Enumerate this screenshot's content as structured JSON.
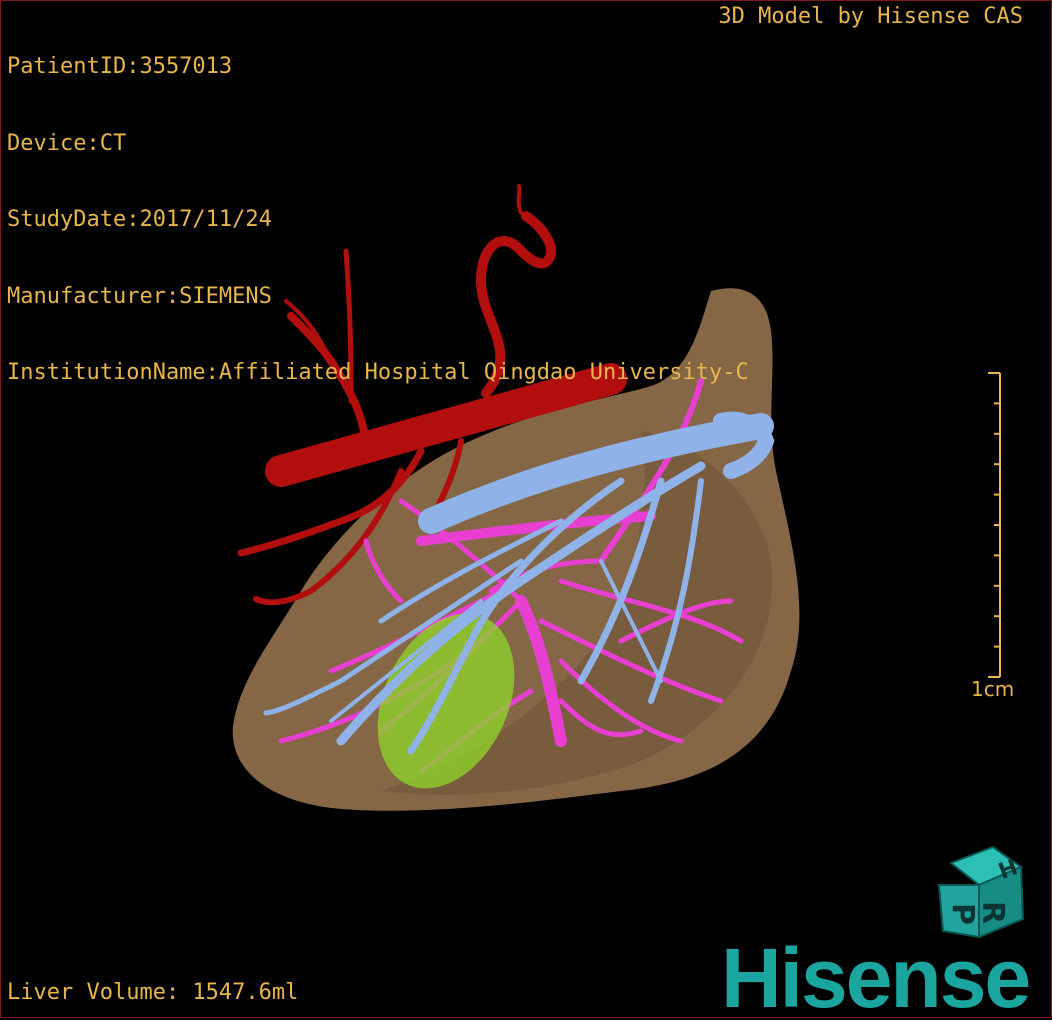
{
  "study": {
    "patient_id": "PatientID:3557013",
    "device": "Device:CT",
    "study_date": "StudyDate:2017/11/24",
    "manufacturer": "Manufacturer:SIEMENS",
    "institution": "InstitutionName:Affiliated Hospital Qingdao University-C"
  },
  "credit": "3D Model by Hisense CAS",
  "liver_volume": "Liver Volume: 1547.6ml",
  "scale": {
    "label": "1cm",
    "ticks": 10
  },
  "orientation_cube": {
    "faces": [
      "P",
      "R",
      "H"
    ]
  },
  "brand": "Hisense",
  "colors": {
    "overlay_text": "#e8b64a",
    "liver": "#8c6d49",
    "artery": "#b30e0e",
    "portal_vein": "#e83fd2",
    "hepatic_vein": "#8fb3e8",
    "lesion": "#8fd12a",
    "brand": "#1aa59e"
  }
}
